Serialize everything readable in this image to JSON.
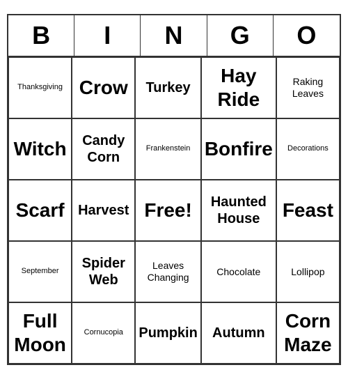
{
  "header": {
    "letters": [
      "B",
      "I",
      "N",
      "G",
      "O"
    ]
  },
  "cells": [
    {
      "text": "Thanksgiving",
      "size": "small"
    },
    {
      "text": "Crow",
      "size": "xlarge"
    },
    {
      "text": "Turkey",
      "size": "large"
    },
    {
      "text": "Hay Ride",
      "size": "xlarge"
    },
    {
      "text": "Raking Leaves",
      "size": "medium"
    },
    {
      "text": "Witch",
      "size": "xlarge"
    },
    {
      "text": "Candy Corn",
      "size": "large"
    },
    {
      "text": "Frankenstein",
      "size": "small"
    },
    {
      "text": "Bonfire",
      "size": "xlarge"
    },
    {
      "text": "Decorations",
      "size": "small"
    },
    {
      "text": "Scarf",
      "size": "xlarge"
    },
    {
      "text": "Harvest",
      "size": "large"
    },
    {
      "text": "Free!",
      "size": "xlarge"
    },
    {
      "text": "Haunted House",
      "size": "large"
    },
    {
      "text": "Feast",
      "size": "xlarge"
    },
    {
      "text": "September",
      "size": "small"
    },
    {
      "text": "Spider Web",
      "size": "large"
    },
    {
      "text": "Leaves Changing",
      "size": "medium"
    },
    {
      "text": "Chocolate",
      "size": "medium"
    },
    {
      "text": "Lollipop",
      "size": "medium"
    },
    {
      "text": "Full Moon",
      "size": "xlarge"
    },
    {
      "text": "Cornucopia",
      "size": "small"
    },
    {
      "text": "Pumpkin",
      "size": "large"
    },
    {
      "text": "Autumn",
      "size": "large"
    },
    {
      "text": "Corn Maze",
      "size": "xlarge"
    }
  ]
}
